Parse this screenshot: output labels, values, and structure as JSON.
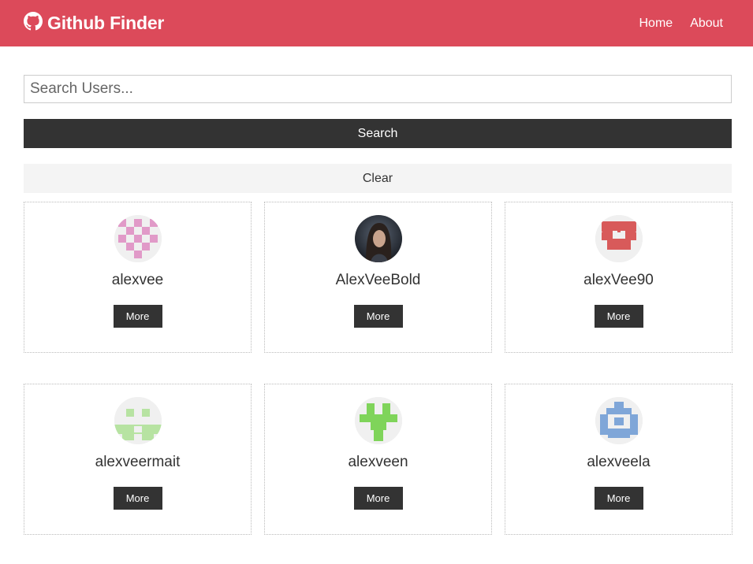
{
  "navbar": {
    "icon": "github-icon",
    "title": "Github Finder",
    "links": [
      "Home",
      "About"
    ],
    "color": "#dc4a5a"
  },
  "search": {
    "placeholder": "Search Users...",
    "value": "",
    "submit_label": "Search",
    "clear_label": "Clear"
  },
  "users": [
    {
      "login": "alexvee",
      "more_label": "More",
      "avatar_color": "#e19ac8"
    },
    {
      "login": "AlexVeeBold",
      "more_label": "More",
      "avatar_color": "#2b2f38"
    },
    {
      "login": "alexVee90",
      "more_label": "More",
      "avatar_color": "#d85a5a"
    },
    {
      "login": "alexveermait",
      "more_label": "More",
      "avatar_color": "#b7e3a2"
    },
    {
      "login": "alexveen",
      "more_label": "More",
      "avatar_color": "#7fd45a"
    },
    {
      "login": "alexveela",
      "more_label": "More",
      "avatar_color": "#7fa6d8"
    }
  ]
}
